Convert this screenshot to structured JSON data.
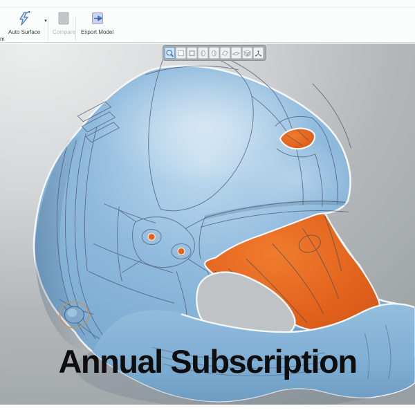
{
  "ribbon": {
    "truncated_label": "m",
    "auto_surface": {
      "label": "Auto Surface",
      "has_dropdown": true
    },
    "compare": {
      "label": "Compare",
      "disabled": true
    },
    "export_model": {
      "label": "Export Model"
    }
  },
  "view_toolbar": {
    "buttons": [
      {
        "name": "zoom",
        "selected": true
      },
      {
        "name": "front-view"
      },
      {
        "name": "back-view"
      },
      {
        "name": "left-view"
      },
      {
        "name": "right-view"
      },
      {
        "name": "top-view"
      },
      {
        "name": "bottom-view"
      },
      {
        "name": "isometric-view"
      },
      {
        "name": "coordinate-axes"
      }
    ]
  },
  "viewport": {
    "overlay_text": "Annual Subscription",
    "model": {
      "name": "helmet-3d-scan",
      "shell_color": "#7fb0d6",
      "interior_color": "#e2611c",
      "wireframe_color": "#4e5c78",
      "rim_color": "#f3f6f7",
      "background_top": "#edeeee",
      "background_bottom": "#989ea1"
    }
  }
}
